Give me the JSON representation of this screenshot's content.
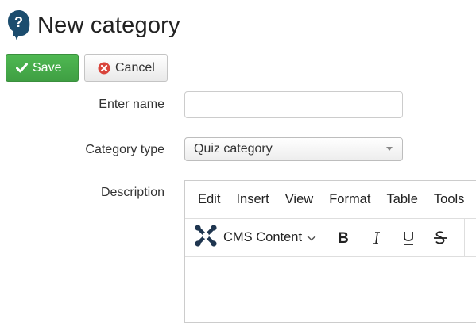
{
  "page": {
    "title": "New category"
  },
  "toolbar": {
    "save_label": "Save",
    "cancel_label": "Cancel"
  },
  "form": {
    "name_label": "Enter name",
    "name_value": "",
    "type_label": "Category type",
    "type_value": "Quiz category",
    "description_label": "Description"
  },
  "editor": {
    "menu": [
      "Edit",
      "Insert",
      "View",
      "Format",
      "Table",
      "Tools"
    ],
    "format_dropdown_label": "CMS Content"
  },
  "colors": {
    "save": "#46ab49",
    "logo": "#1c4d6e",
    "cancel_icon": "#d9443b"
  }
}
